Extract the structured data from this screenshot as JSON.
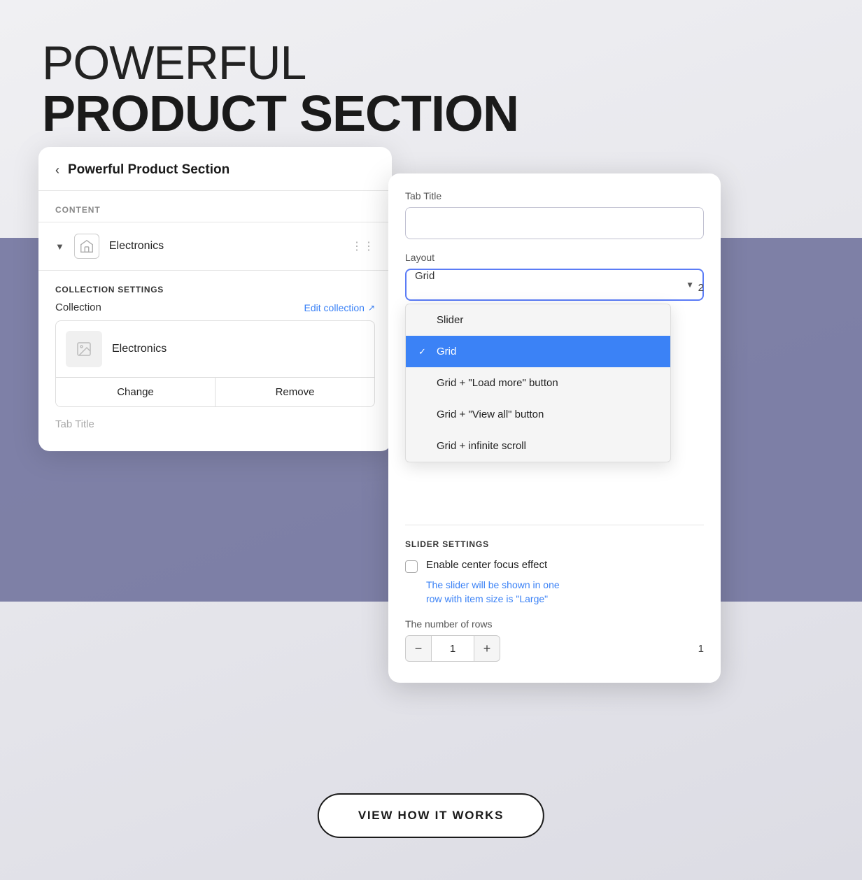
{
  "page": {
    "bg_color": "#e8e8ec",
    "purple_band_color": "#6b6d9a"
  },
  "main_title": {
    "line1": "POWERFUL",
    "line2": "PRODUCT SECTION"
  },
  "left_card": {
    "back_label": "‹",
    "title": "Powerful Product Section",
    "content_label": "CONTENT",
    "item": {
      "name": "Electronics"
    },
    "collection_settings": {
      "section_title": "COLLECTION SETTINGS",
      "collection_label": "Collection",
      "edit_link": "Edit collection",
      "item_name": "Electronics",
      "change_btn": "Change",
      "remove_btn": "Remove"
    },
    "tab_title_placeholder": "Tab Title"
  },
  "right_card": {
    "tab_title_label": "Tab Title",
    "tab_title_placeholder": "",
    "layout_label": "Layout",
    "layout_selected": "Grid",
    "layout_options": [
      {
        "value": "Slider",
        "label": "Slider",
        "selected": false
      },
      {
        "value": "Grid",
        "label": "Grid",
        "selected": true
      },
      {
        "value": "Grid_load_more",
        "label": "Grid + \"Load more\" button",
        "selected": false
      },
      {
        "value": "Grid_view_all",
        "label": "Grid + \"View all\" button",
        "selected": false
      },
      {
        "value": "Grid_infinite",
        "label": "Grid + infinite scroll",
        "selected": false
      }
    ],
    "rows_count": "2",
    "slider_settings": {
      "title": "SLIDER SETTINGS",
      "checkbox_label": "Enable center focus effect",
      "checkbox_hint_line1": "The slider will be shown in one",
      "checkbox_hint_line2": "row with item size is \"Large\"",
      "rows_label": "The number of rows",
      "rows_value": "1"
    }
  },
  "view_button": {
    "label": "VIEW HOW IT WORKS"
  }
}
